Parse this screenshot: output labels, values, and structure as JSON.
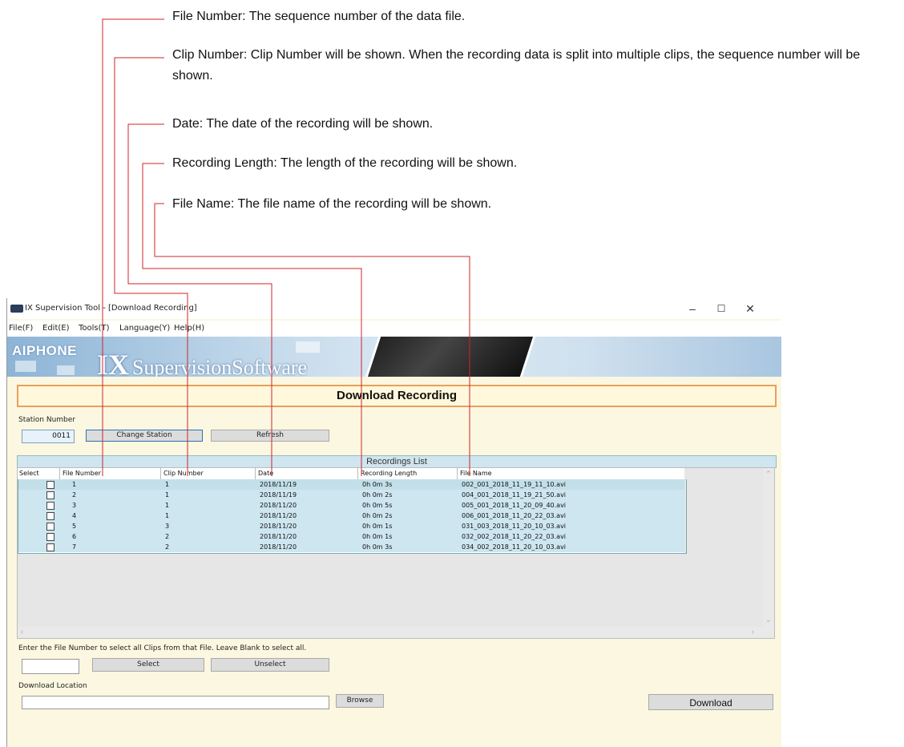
{
  "annotations": [
    {
      "id": "file-number",
      "text": "File Number: The sequence number of the data file."
    },
    {
      "id": "clip-number",
      "text": "Clip Number: Clip Number will be shown. When the recording data is split into multiple clips, the sequence number will be shown."
    },
    {
      "id": "date",
      "text": "Date: The date of the recording will be shown."
    },
    {
      "id": "recording-length",
      "text": "Recording Length: The length of the recording will be shown."
    },
    {
      "id": "file-name",
      "text": "File Name: The file name of the recording will be shown."
    }
  ],
  "window": {
    "title": "IX Supervision Tool - [Download Recording]",
    "controls": {
      "minimize": "–",
      "maximize": "☐",
      "close": "✕"
    }
  },
  "menu": [
    "File(F)",
    "Edit(E)",
    "Tools(T)",
    "Language(Y)",
    "Help(H)"
  ],
  "banner": {
    "logo": "AIPHONE",
    "product_ix": "IX",
    "product_rest": "SupervisionSoftware"
  },
  "page_title": "Download Recording",
  "station": {
    "label": "Station Number",
    "value": "0011",
    "change_button": "Change Station",
    "refresh_button": "Refresh"
  },
  "recordings": {
    "title": "Recordings List",
    "columns": [
      "Select",
      "File Number",
      "Clip Number",
      "Date",
      "Recording Length",
      "File Name"
    ],
    "rows": [
      {
        "file": "1",
        "clip": "1",
        "date": "2018/11/19",
        "length": "0h 0m 3s",
        "name": "002_001_2018_11_19_11_10.avi"
      },
      {
        "file": "2",
        "clip": "1",
        "date": "2018/11/19",
        "length": "0h 0m 2s",
        "name": "004_001_2018_11_19_21_50.avi"
      },
      {
        "file": "3",
        "clip": "1",
        "date": "2018/11/20",
        "length": "0h 0m 5s",
        "name": "005_001_2018_11_20_09_40.avi"
      },
      {
        "file": "4",
        "clip": "1",
        "date": "2018/11/20",
        "length": "0h 0m 2s",
        "name": "006_001_2018_11_20_22_03.avi"
      },
      {
        "file": "5",
        "clip": "3",
        "date": "2018/11/20",
        "length": "0h 0m 1s",
        "name": "031_003_2018_11_20_10_03.avi"
      },
      {
        "file": "6",
        "clip": "2",
        "date": "2018/11/20",
        "length": "0h 0m 1s",
        "name": "032_002_2018_11_20_22_03.avi"
      },
      {
        "file": "7",
        "clip": "2",
        "date": "2018/11/20",
        "length": "0h 0m 3s",
        "name": "034_002_2018_11_20_10_03.avi"
      }
    ]
  },
  "select_section": {
    "instruction": "Enter the File Number to select all Clips from that File. Leave Blank to select all.",
    "input_value": "",
    "select_button": "Select",
    "unselect_button": "Unselect"
  },
  "download": {
    "label": "Download Location",
    "path_value": "",
    "browse_button": "Browse",
    "download_button": "Download"
  },
  "colors": {
    "callout_line": "#d0242a",
    "header_border": "#e7a05a",
    "row_bg": "#cde6f0",
    "window_bg": "#fbf7e0"
  }
}
